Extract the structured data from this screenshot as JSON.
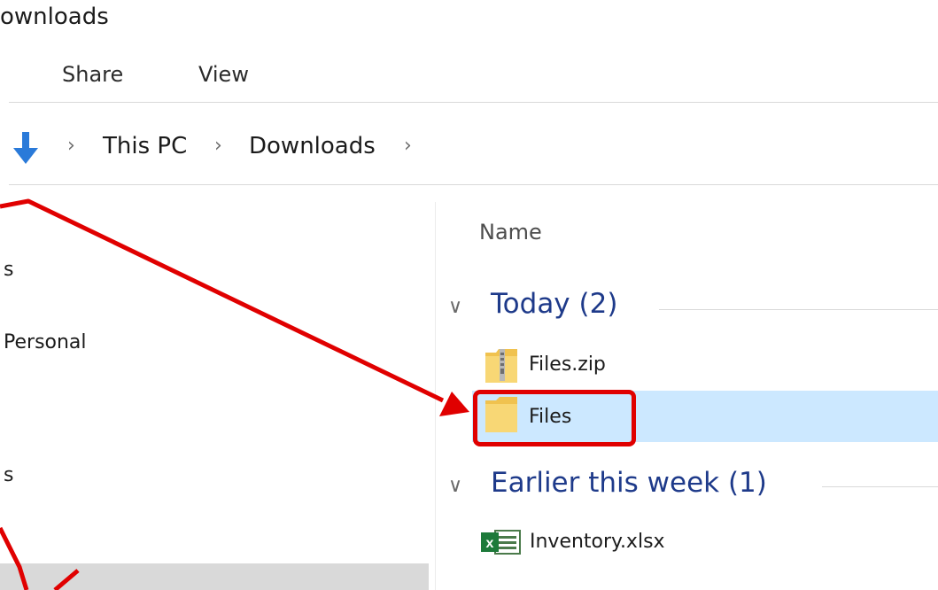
{
  "window": {
    "title": "ownloads"
  },
  "ribbon": {
    "tabs": [
      "Share",
      "View"
    ]
  },
  "address": {
    "crumbs": [
      "This PC",
      "Downloads"
    ]
  },
  "nav": {
    "items": [
      "s",
      "Personal",
      "s"
    ]
  },
  "list": {
    "column_header": "Name",
    "groups": [
      {
        "label": "Today (2)",
        "files": [
          "Files.zip",
          "Files"
        ]
      },
      {
        "label": "Earlier this week (1)",
        "files": [
          "Inventory.xlsx"
        ]
      }
    ]
  },
  "colors": {
    "annotation": "#e00000",
    "selection": "#cce8ff",
    "group_text": "#1e3a8a",
    "folder": "#f8d775"
  },
  "icons": {
    "address": "download-arrow-icon",
    "zip": "zip-folder-icon",
    "folder": "folder-icon",
    "excel": "excel-file-icon"
  }
}
